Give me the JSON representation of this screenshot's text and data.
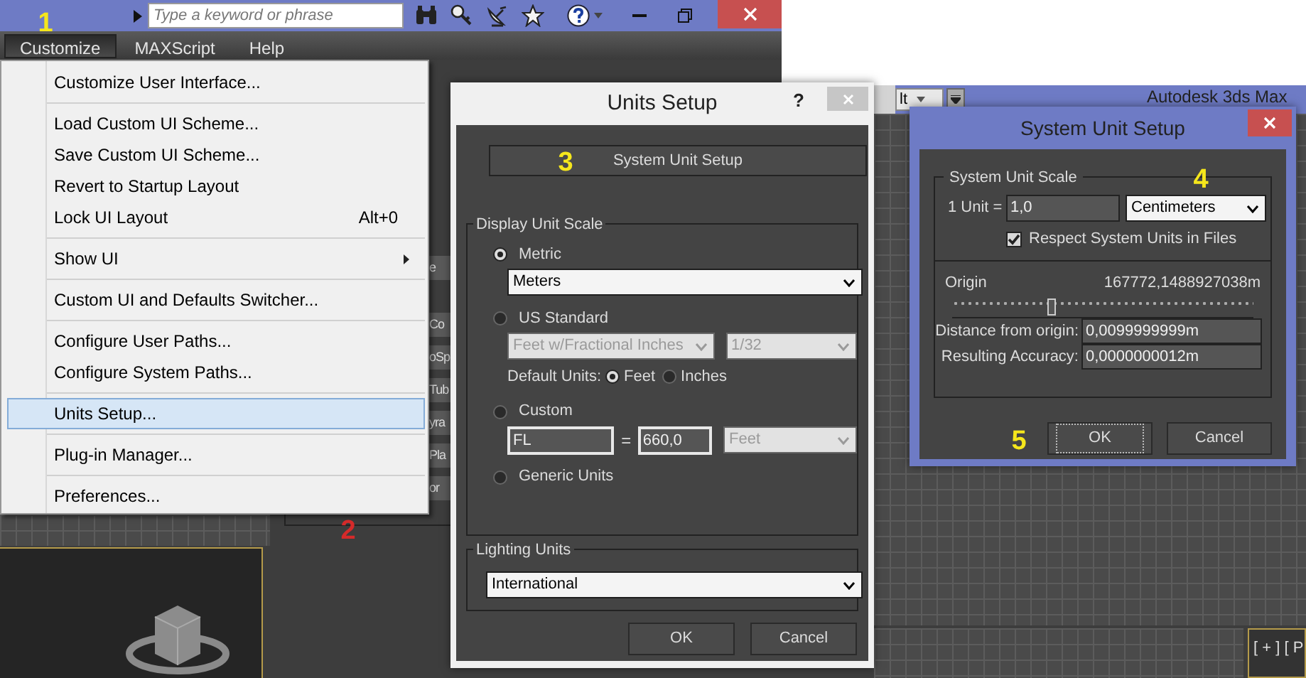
{
  "top_bar": {
    "search_placeholder": "Type a keyword or phrase"
  },
  "menu_bar": [
    {
      "label": "Customize",
      "selected": true
    },
    {
      "label": "MAXScript",
      "selected": false
    },
    {
      "label": "Help",
      "selected": false
    }
  ],
  "customize_menu": {
    "groups": [
      [
        {
          "label": "Customize User Interface...",
          "selected": false,
          "submenu": false
        }
      ],
      [
        {
          "label": "Load Custom UI Scheme...",
          "selected": false,
          "submenu": false
        },
        {
          "label": "Save Custom UI Scheme...",
          "selected": false,
          "submenu": false
        },
        {
          "label": "Revert to Startup Layout",
          "selected": false,
          "submenu": false
        },
        {
          "label": "Lock UI Layout",
          "shortcut": "Alt+0",
          "selected": false,
          "submenu": false
        }
      ],
      [
        {
          "label": "Show UI",
          "selected": false,
          "submenu": true
        }
      ],
      [
        {
          "label": "Custom UI and Defaults Switcher...",
          "selected": false,
          "submenu": false
        }
      ],
      [
        {
          "label": "Configure User Paths...",
          "selected": false,
          "submenu": false
        },
        {
          "label": "Configure System Paths...",
          "selected": false,
          "submenu": false
        }
      ],
      [
        {
          "label": "Units Setup...",
          "selected": true,
          "submenu": false
        }
      ],
      [
        {
          "label": "Plug-in Manager...",
          "selected": false,
          "submenu": false
        }
      ],
      [
        {
          "label": "Preferences...",
          "selected": false,
          "submenu": false
        }
      ]
    ]
  },
  "panel_fragments": [
    "e",
    "Co",
    "oSp",
    "Tub",
    "yra",
    "Pla",
    "or"
  ],
  "background_window": {
    "dropdown": "lt",
    "title": "Autodesk 3ds Max",
    "viewport_label": "[ + ] [ P"
  },
  "units_setup": {
    "title": "Units Setup",
    "help": "?",
    "system_unit_setup_button": "System Unit Setup",
    "display_unit_scale": {
      "title": "Display Unit Scale",
      "options": [
        {
          "kind": "metric",
          "label": "Metric",
          "selected": true,
          "dropdown": {
            "value": "Meters",
            "disabled": false
          }
        },
        {
          "kind": "us",
          "label": "US Standard",
          "selected": false,
          "dropdowns": [
            {
              "value": "Feet w/Fractional Inches",
              "disabled": true
            },
            {
              "value": "1/32",
              "disabled": true
            }
          ],
          "default_units": {
            "label": "Default Units:",
            "options": [
              {
                "label": "Feet",
                "selected": true
              },
              {
                "label": "Inches",
                "selected": false
              }
            ]
          }
        },
        {
          "kind": "custom",
          "label": "Custom",
          "selected": false,
          "name_value": "FL",
          "equals": "=",
          "amount": "660,0",
          "dropdown": {
            "value": "Feet",
            "disabled": true
          }
        },
        {
          "kind": "generic",
          "label": "Generic Units",
          "selected": false
        }
      ]
    },
    "lighting_units": {
      "title": "Lighting Units",
      "dropdown": {
        "value": "International",
        "disabled": false
      }
    },
    "buttons": [
      {
        "label": "OK",
        "focused": false
      },
      {
        "label": "Cancel",
        "focused": false
      }
    ]
  },
  "system_unit_setup": {
    "title": "System Unit Setup",
    "scale": {
      "title": "System Unit Scale",
      "unit_label": "1 Unit =",
      "unit_value": "1,0",
      "unit_type": {
        "value": "Centimeters",
        "disabled": false
      },
      "respect_units": {
        "label": "Respect System Units in Files",
        "checked": true
      }
    },
    "origin": {
      "label": "Origin",
      "value": "167772,1488927038m",
      "level": 0.33
    },
    "fields": [
      {
        "label": "Distance from origin:",
        "value": "0,0099999999m"
      },
      {
        "label": "Resulting Accuracy:",
        "value": "0,0000000012m"
      }
    ],
    "buttons": [
      {
        "label": "OK",
        "focused": true
      },
      {
        "label": "Cancel",
        "focused": false
      }
    ]
  },
  "annotations": [
    {
      "label": "1",
      "color": "#f5e61c"
    },
    {
      "label": "2",
      "color": "#d42a2a"
    },
    {
      "label": "3",
      "color": "#f5e61c"
    },
    {
      "label": "4",
      "color": "#f5e61c"
    },
    {
      "label": "5",
      "color": "#f5e61c"
    }
  ]
}
